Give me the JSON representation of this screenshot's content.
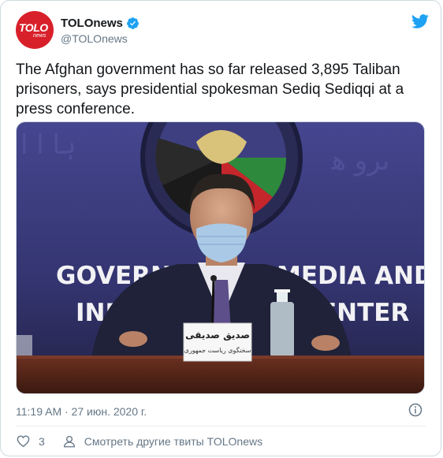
{
  "tweet": {
    "author": {
      "display_name": "TOLOnews",
      "handle": "@TOLOnews",
      "verified": true,
      "avatar_logo": "TOLO",
      "avatar_logo_sub": "news"
    },
    "text": "The Afghan government has so far released 3,895 Taliban prisoners, says presidential spokesman Sediq Sediqqi at a press conference.",
    "media": {
      "backdrop_line_1": "GOVERN  MEDIA AND",
      "backdrop_line_1_left": "GOVERN",
      "backdrop_line_1_right": "MEDIA AND",
      "backdrop_line_2_left": "INFO",
      "backdrop_line_2_right": "ENTER",
      "placard_line_1": "صدیق صدیقی",
      "placard_line_2": "سخنگوی ریاست جمهوری",
      "seal_text": "GOVERNMENT MEDIA AND INFORMATION CENTER"
    },
    "timestamp": "11:19 AM · 27 июн. 2020 г.",
    "likes": "3",
    "more_tweets_label": "Смотреть другие твиты TOLOnews"
  },
  "colors": {
    "brand_red": "#d8202a",
    "twitter_blue": "#1da1f2",
    "backdrop_purple": "#3b3b84",
    "text_secondary": "#657786"
  },
  "icons": {
    "verified": "verified-badge-icon",
    "twitter": "twitter-bird-icon",
    "info": "info-icon",
    "heart": "heart-icon",
    "person": "person-icon"
  }
}
